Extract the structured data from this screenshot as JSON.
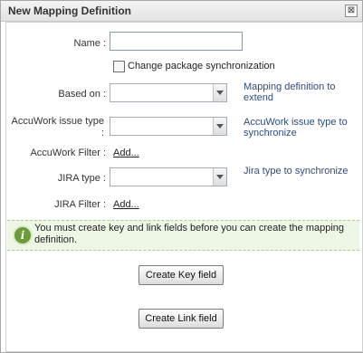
{
  "dialog": {
    "title": "New Mapping Definition",
    "close_glyph": "⊠"
  },
  "form": {
    "name_label": "Name :",
    "name_value": "",
    "change_sync_label": "Change package synchronization",
    "based_on_label": "Based on :",
    "based_on_value": "",
    "based_on_hint": "Mapping definition to extend",
    "accuwork_type_label": "AccuWork issue type :",
    "accuwork_type_value": "",
    "accuwork_type_hint": "AccuWork issue type to synchronize",
    "accuwork_filter_label": "AccuWork Filter :",
    "accuwork_filter_link": "Add...",
    "jira_type_label": "JIRA type :",
    "jira_type_value": "",
    "jira_type_hint": "Jira type to synchronize",
    "jira_filter_label": "JIRA Filter :",
    "jira_filter_link": "Add..."
  },
  "info": {
    "icon": "info-icon",
    "message": "You must create key and link fields before you can create the mapping definition."
  },
  "buttons": {
    "create_key": "Create Key field",
    "create_link": "Create Link field"
  }
}
